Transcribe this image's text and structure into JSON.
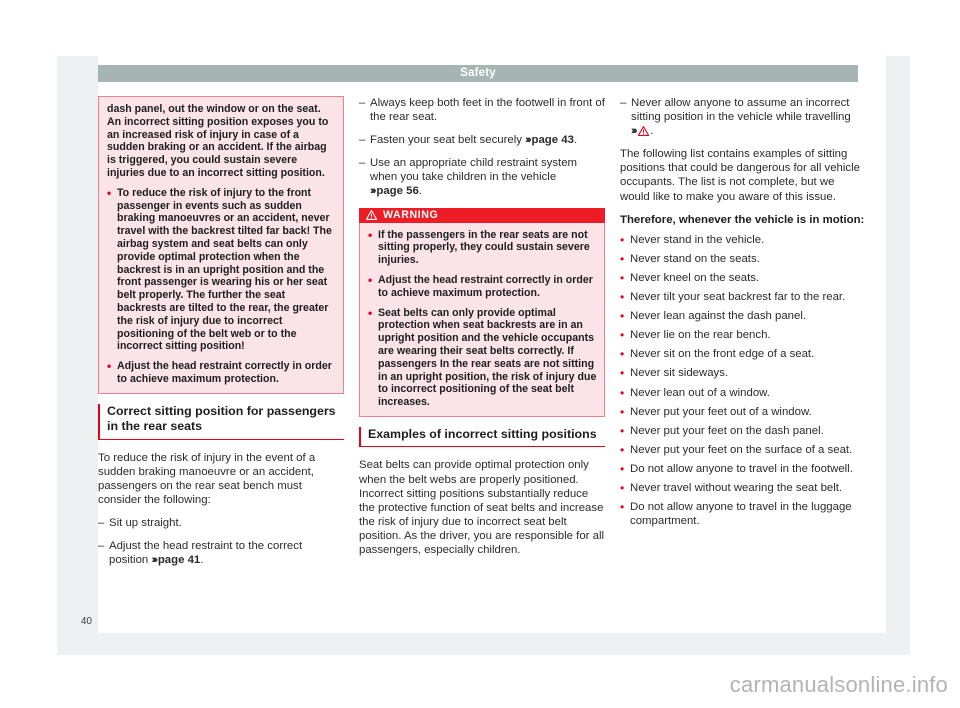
{
  "page": {
    "header_title": "Safety",
    "page_number": "40",
    "watermark": "carmanualsonline.info"
  },
  "left_column": {
    "note_box": {
      "paragraphs": [
        {
          "bullet": false,
          "text": "dash panel, out the window or on the seat. An incorrect sitting position exposes you to an increased risk of injury in case of a sudden braking or an accident. If the airbag is triggered, you could sustain severe injuries due to an incorrect sitting position."
        },
        {
          "bullet": true,
          "text": "To reduce the risk of injury to the front passenger in events such as sudden braking manoeuvres or an accident, never travel with the backrest tilted far back! The airbag system and seat belts can only provide optimal protection when the backrest is in an upright position and the front passenger is wearing his or her seat belt properly. The further the seat backrests are tilted to the rear, the greater the risk of injury due to incorrect positioning of the belt web or to the incorrect sitting position!"
        },
        {
          "bullet": true,
          "text": "Adjust the head restraint correctly in order to achieve maximum protection."
        }
      ]
    },
    "heading": "Correct sitting position for passengers in the rear seats",
    "intro": "To reduce the risk of injury in the event of a sudden braking manoeuvre or an accident, passengers on the rear seat bench must consider the following:",
    "items": [
      {
        "text": "Sit up straight.",
        "ref": ""
      },
      {
        "text": "Adjust the head restraint to the correct position",
        "ref": "page 41",
        "tail": "."
      }
    ]
  },
  "middle_column": {
    "items": [
      {
        "text": "Always keep both feet in the footwell in front of the rear seat.",
        "ref": "",
        "tail": ""
      },
      {
        "text": "Fasten your seat belt securely",
        "ref": "page 43",
        "tail": "."
      },
      {
        "text": "Use an appropriate child restraint system when you take children in the vehicle",
        "ref": "page 56",
        "tail": "."
      }
    ],
    "warning": {
      "label": "WARNING",
      "icon": "warning-triangle-icon",
      "items": [
        "If the passengers in the rear seats are not sitting properly, they could sustain severe injuries.",
        "Adjust the head restraint correctly in order to achieve maximum protection.",
        "Seat belts can only provide optimal protection when seat backrests are in an upright position and the vehicle occupants are wearing their seat belts correctly. If passengers In the rear seats are not sitting in an upright position, the risk of injury due to incorrect positioning of the seat belt increases."
      ]
    },
    "heading": "Examples of incorrect sitting positions",
    "body": "Seat belts can provide optimal protection only when the belt webs are properly positioned. Incorrect sitting positions substantially reduce the protective function of seat belts and increase the risk of injury due to incorrect seat belt position. As the driver, you are responsible for all passengers, especially children."
  },
  "right_column": {
    "lead_item": {
      "text": "Never allow anyone to assume an incorrect sitting position in the vehicle while travelling",
      "ref_icon": "warning-triangle-icon",
      "tail": "."
    },
    "body": "The following list contains examples of sitting positions that could be dangerous for all vehicle occupants. The list is not complete, but we would like to make you aware of this issue.",
    "lead_bold": "Therefore, whenever the vehicle is in motion:",
    "bullets": [
      "Never stand in the vehicle.",
      "Never stand on the seats.",
      "Never kneel on the seats.",
      "Never tilt your seat backrest far to the rear.",
      "Never lean against the dash panel.",
      "Never lie on the rear bench.",
      "Never sit on the front edge of a seat.",
      "Never sit sideways.",
      "Never lean out of a window.",
      "Never put your feet out of a window.",
      "Never put your feet on the dash panel.",
      "Never put your feet on the surface of a seat.",
      "Do not allow anyone to travel in the footwell.",
      "Never travel without wearing the seat belt.",
      "Do not allow anyone to travel in the luggage compartment."
    ]
  },
  "colors": {
    "accent_red": "#e2001a",
    "warning_red": "#ee1c25",
    "note_pink_bg": "#fbe4e8",
    "note_pink_border": "#f08090",
    "header_grey": "#a6b4b4",
    "page_grey": "#eef1f2"
  }
}
